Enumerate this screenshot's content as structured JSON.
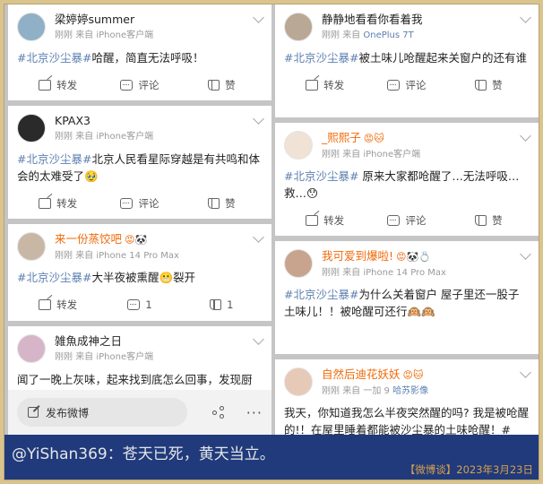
{
  "actions": {
    "share": "转发",
    "comment": "评论",
    "like": "赞"
  },
  "posts_left": [
    {
      "name": "梁婷婷summer",
      "name_style": "normal",
      "badges": "",
      "meta_time": "刚刚",
      "meta_source": "来自 iPhone客户端",
      "text_tag": "#北京沙尘暴#",
      "text": "哈醒，简直无法呼吸！",
      "comment_count": "",
      "like_count": "",
      "avatar_color": "#8fb0c7"
    },
    {
      "name": "KPAX3",
      "name_style": "normal",
      "badges": "",
      "meta_time": "刚刚",
      "meta_source": "来自 iPhone客户端",
      "text_tag": "#北京沙尘暴#",
      "text": "北京人民看星际穿越是有共鸣和体会的太难受了🥹",
      "comment_count": "",
      "like_count": "",
      "avatar_color": "#2a2a2a"
    },
    {
      "name": "来一份蒸饺吧",
      "name_style": "orange",
      "badges": "😡🐼",
      "meta_time": "刚刚",
      "meta_source": "来自 iPhone 14 Pro Max",
      "text_tag": "#北京沙尘暴#",
      "text": "大半夜被熏醒😬裂开",
      "comment_count": "1",
      "like_count": "1",
      "avatar_color": "#c9b7a6"
    },
    {
      "name": "雑魚成神之日",
      "name_style": "normal",
      "badges": "",
      "meta_time": "刚刚",
      "meta_source": "来自 iPhone客户端",
      "text_tag": "",
      "text": "闻了一晚上灰味，起来找到底怎么回事，发现厨",
      "comment_count": "",
      "like_count": "",
      "avatar_color": "#d7b5c8"
    }
  ],
  "posts_right": [
    {
      "name": "静静地看看你看着我",
      "name_style": "normal",
      "badges": "",
      "meta_time": "刚刚",
      "meta_source": "来自",
      "meta_link": "OnePlus 7T",
      "text_tag": "#北京沙尘暴#",
      "text": "被土味儿呛醒起来关窗户的还有谁",
      "comment_count": "",
      "like_count": "",
      "avatar_color": "#b9a896"
    },
    {
      "name": "_熙熙子",
      "name_style": "orange",
      "badges": "😡🐱",
      "meta_time": "刚刚",
      "meta_source": "来自 iPhone客户端",
      "meta_link": "",
      "text_tag": "#北京沙尘暴#",
      "text": " 原来大家都呛醒了…无法呼吸…救…😯",
      "comment_count": "",
      "like_count": "",
      "avatar_color": "#f1e2d6"
    },
    {
      "name": "我可爱到爆啦!",
      "name_style": "orange",
      "badges": "😡🐼💍",
      "meta_time": "刚刚",
      "meta_source": "来自 iPhone 14 Pro Max",
      "meta_link": "",
      "text_tag": "#北京沙尘暴#",
      "text": "为什么关着窗户 屋子里还一股子土味儿！！被呛醒可还行🙉🙉",
      "comment_count": "",
      "like_count": "",
      "avatar_color": "#c8a48e"
    },
    {
      "name": "自然后迪花妖妖",
      "name_style": "orange",
      "badges": "😡🐱",
      "meta_time": "刚刚",
      "meta_source": "来自 一加 9",
      "meta_link": "哈苏影像",
      "text_tag": "",
      "text": "我天，你知道我怎么半夜突然醒的吗? 我是被呛醒的!！在屋里睡着都能被沙尘暴的土味呛醒！#",
      "comment_count": "",
      "like_count": "",
      "avatar_color": "#e7c9b7"
    }
  ],
  "composer": {
    "label": "发布微博",
    "more": "···"
  },
  "banner": {
    "quote": "@YiShan369：苍天已死，黄天当立。",
    "source": "【微博谈】2023年3月23日"
  }
}
